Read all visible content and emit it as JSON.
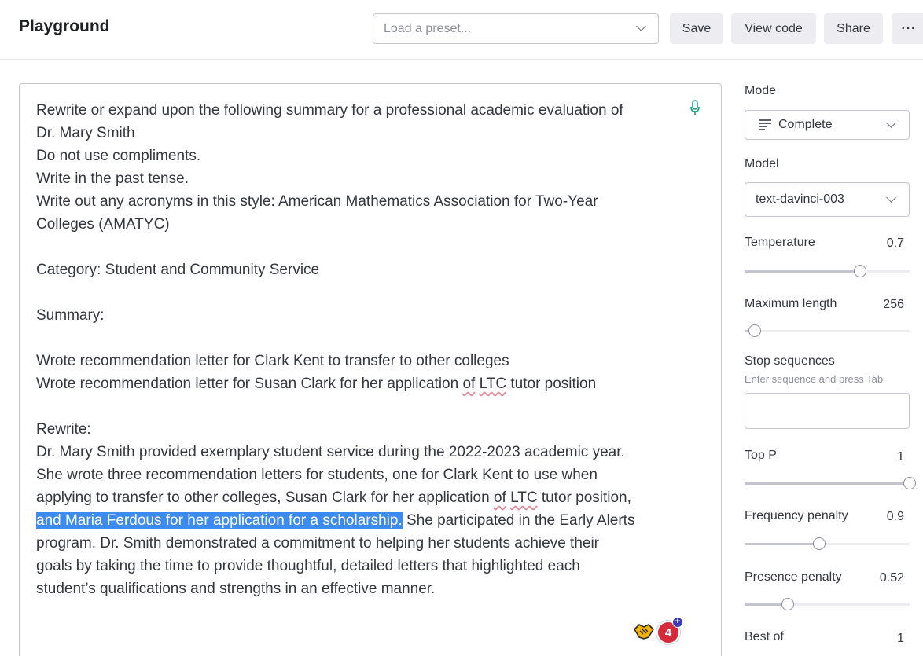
{
  "header": {
    "title": "Playground",
    "preset_placeholder": "Load a preset...",
    "save_label": "Save",
    "view_code_label": "View code",
    "share_label": "Share",
    "more_label": "···"
  },
  "editor": {
    "lines": [
      "Rewrite or expand upon the following summary for a professional academic evaluation of",
      "Dr. Mary Smith",
      "Do not use compliments.",
      "Write in the past tense.",
      "Write out any acronyms in this style: American Mathematics Association for Two-Year",
      "Colleges (AMATYC)",
      "",
      "Category: Student and Community Service",
      "",
      "Summary:",
      "",
      "Wrote recommendation letter for Clark Kent to transfer to other colleges",
      "",
      "",
      "Rewrite:",
      "Dr. Mary Smith provided exemplary student service during the 2022-2023 academic year.",
      "She wrote three recommendation letters for students, one for Clark Kent to use when",
      "",
      "",
      "program. Dr. Smith demonstrated a commitment to helping her students achieve their",
      "goals by taking the time to provide thoughtful, detailed letters that highlighted each",
      "student’s qualifications and strengths in an effective manner."
    ],
    "line13_a": "Wrote recommendation letter for Susan Clark for her application ",
    "line13_of": "of",
    "line13_ltc": "LTC",
    "line13_b": " tutor position",
    "line18_a": "applying to transfer to other colleges, Susan Clark for her application ",
    "line18_of": "of",
    "line18_ltc": "LTC",
    "line18_b": " tutor position,",
    "line19_highlight": "and Maria Ferdous for her application for a scholarship.",
    "line19_rest": " She participated in the Early Alerts",
    "badge_count": "4",
    "badge_plus": "+"
  },
  "settings": {
    "mode_label": "Mode",
    "mode_value": "Complete",
    "model_label": "Model",
    "model_value": "text-davinci-003",
    "temperature_label": "Temperature",
    "temperature_value": "0.7",
    "temperature_fraction": 0.7,
    "max_length_label": "Maximum length",
    "max_length_value": "256",
    "max_length_fraction": 0.06,
    "stop_label": "Stop sequences",
    "stop_hint": "Enter sequence and press Tab",
    "top_p_label": "Top P",
    "top_p_value": "1",
    "top_p_fraction": 1.0,
    "freq_label": "Frequency penalty",
    "freq_value": "0.9",
    "freq_fraction": 0.45,
    "presence_label": "Presence penalty",
    "presence_value": "0.52",
    "presence_fraction": 0.26,
    "best_of_label": "Best of",
    "best_of_value": "1"
  }
}
